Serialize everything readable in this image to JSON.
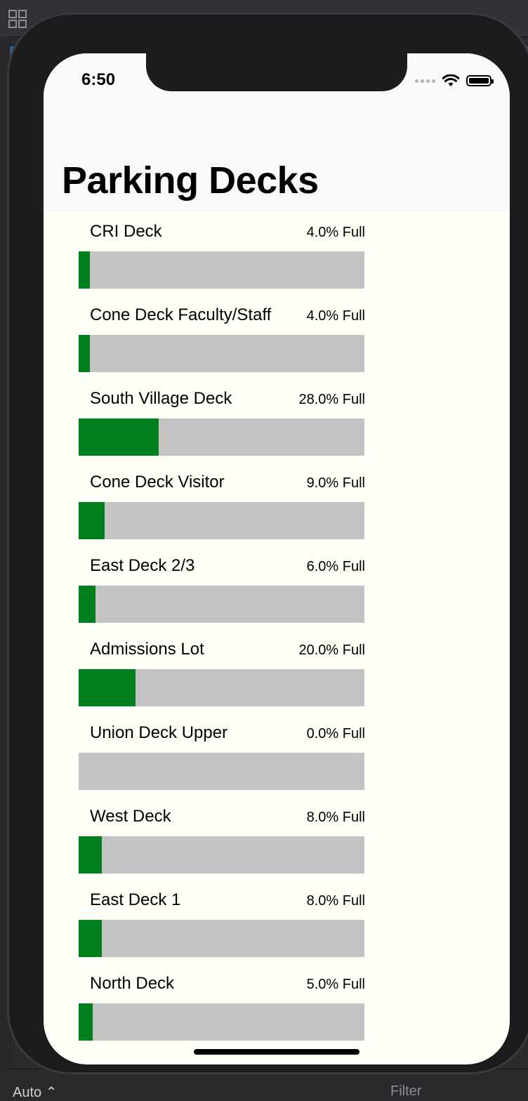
{
  "window": {
    "bottom_left": "Auto ⌃",
    "bottom_filter": "Filter"
  },
  "status": {
    "time": "6:50"
  },
  "page": {
    "title": "Parking Decks"
  },
  "colors": {
    "fill": "#007f1f",
    "track": "#c3c3c3"
  },
  "decks": [
    {
      "name": "CRI Deck",
      "percent_label": "4.0% Full",
      "fill": 0.04
    },
    {
      "name": "Cone Deck Faculty/Staff",
      "percent_label": "4.0% Full",
      "fill": 0.04
    },
    {
      "name": "South Village Deck",
      "percent_label": "28.0% Full",
      "fill": 0.28
    },
    {
      "name": "Cone Deck Visitor",
      "percent_label": "9.0% Full",
      "fill": 0.09
    },
    {
      "name": "East Deck 2/3",
      "percent_label": "6.0% Full",
      "fill": 0.06
    },
    {
      "name": "Admissions Lot",
      "percent_label": "20.0% Full",
      "fill": 0.2
    },
    {
      "name": "Union Deck Upper",
      "percent_label": "0.0% Full",
      "fill": 0.0
    },
    {
      "name": "West Deck",
      "percent_label": "8.0% Full",
      "fill": 0.08
    },
    {
      "name": "East Deck 1",
      "percent_label": "8.0% Full",
      "fill": 0.08
    },
    {
      "name": "North Deck",
      "percent_label": "5.0% Full",
      "fill": 0.05
    }
  ]
}
